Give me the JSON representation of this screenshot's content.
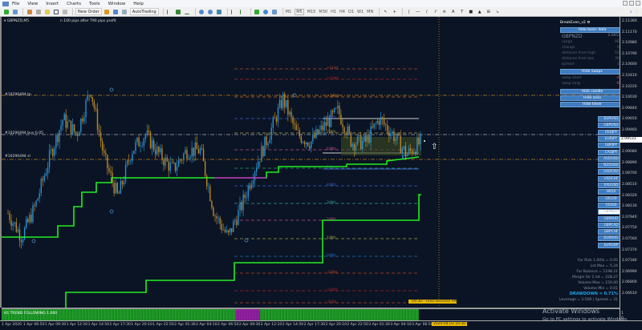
{
  "menu": [
    "File",
    "View",
    "Insert",
    "Charts",
    "Tools",
    "Window",
    "Help"
  ],
  "toolbar": {
    "new_order": "New Order",
    "autotrading": "AutoTrading",
    "timeframes": [
      "M1",
      "M5",
      "M15",
      "M30",
      "H1",
      "H4",
      "D1",
      "W1",
      "MN"
    ]
  },
  "chart": {
    "symbol_label": "GBPNZD,M5",
    "info_text": "n 100 pips after T90 pips profit",
    "indicator_name": "BreakEven_v2",
    "line_labels": [
      "#10290494 tp",
      "#10290494 buy 0.05",
      "#10290494 sl"
    ],
    "murrey_levels": [
      "+1/3d",
      "+2/8th",
      "+1/8th",
      "8/8th",
      "7/8th",
      "6/8th",
      "5/8th",
      "4/8th",
      "3/8th",
      "2/8th",
      "1/8th",
      "0/8th",
      "-1/8th",
      "-2/8th",
      "-1/3d"
    ],
    "news_label": "09:30 - Final Services PMI",
    "subwindow_label": "H1 TREND FOLLOWING 1.000"
  },
  "panel": {
    "hide_basic": "Hide basic data",
    "symbol": "GBPNZD",
    "price": "2.09533",
    "rows": [
      {
        "k": "range",
        "v": "86.4"
      },
      {
        "k": "change",
        "v": "0.0"
      },
      {
        "k": "distance from high",
        "v": "55.8"
      },
      {
        "k": "distance from low",
        "v": "30.6"
      },
      {
        "k": "spread",
        "v": "3.1"
      }
    ],
    "hide_swaps": "Hide swaps",
    "swaps": [
      {
        "k": "swap short",
        "v": "-4.1"
      },
      {
        "k": "swap long",
        "v": "-8.4"
      }
    ],
    "hide_candle": "Hide candle",
    "hide_area": "Hide area",
    "hide_timer": "Hide timer"
  },
  "symbols": [
    "EURUSD",
    "GBPUSD",
    "USDJPY",
    "EURJPY",
    "GBPJPY",
    "CADJPY",
    "AUDUSD",
    "NZDUSD",
    "USDCAD",
    "USDCHF",
    "XAUUSD",
    "HK50",
    "UK100",
    "US500",
    "GBPNZD",
    "GBPAUD",
    "GBPCAD",
    "GBPCHF",
    "EURAUD",
    "EURGBP"
  ],
  "selected_symbol": "GBPNZD",
  "stats": [
    "For Risk 1.00% = 0.05",
    "Lot Max = 5.24",
    "For Balance = 1198.21",
    "Margin for 1 lot = 228.27",
    "Volume Max = 150.00",
    "Volume Min = 0.01"
  ],
  "drawdown": "DRAWDOWN = 0.71%",
  "leverage": "Leverage = 1:500 | Spread = 31",
  "price_axis": [
    "2.11360",
    "2.11170",
    "2.10980",
    "2.10790",
    "2.10600",
    "2.10410",
    "2.10220",
    "2.10030",
    "2.09840",
    "2.09650",
    "2.09460",
    "2.09270",
    "2.09080",
    "2.08890",
    "2.08700",
    "2.08510",
    "2.08320",
    "2.08130",
    "2.07940",
    "2.07750",
    "2.07560",
    "2.07370",
    "2.07180",
    "2.06990",
    "2.06800",
    "2.06610"
  ],
  "current_price": "2.09533",
  "sub_axis": [
    "1",
    "0"
  ],
  "time_axis": [
    "1 Apr 2020",
    "1 Apr 06:50",
    "1 Apr 09:30",
    "1 Apr 12:10",
    "1 Apr 14:50",
    "1 Apr 17:30",
    "1 Apr 20:10",
    "1 Apr 22:50",
    "2 Apr 01:30",
    "2 Apr 04:10",
    "2 Apr 06:50",
    "2 Apr 09:30",
    "2 Apr 12:10",
    "2 Apr 14:50",
    "2 Apr 17:30",
    "2 Apr 20:10",
    "2 Apr 22:50",
    "3 Apr 01:30",
    "3 Apr 04:10",
    "3 Apr 06:50"
  ],
  "time_cursor": "2020.04.03 10:30",
  "watermark": {
    "title": "Activate Windows",
    "sub": "Go to PC settings to activate Windows."
  },
  "colors": {
    "bg": "#0b1424",
    "bull": "#2a8fd0",
    "bear": "#b8892a",
    "trail": "#22ee22",
    "button": "#3f7cc0",
    "drawdown": "#1aa3e8"
  },
  "chart_data": {
    "type": "candlestick",
    "symbol": "GBPNZD",
    "timeframe": "M5",
    "approx_close_path": [
      2.08,
      2.0759,
      2.0814,
      2.0896,
      2.0965,
      2.0938,
      2.1018,
      2.0896,
      2.0828,
      2.091,
      2.0938,
      2.0903,
      2.0876,
      2.091,
      2.091,
      2.08,
      2.0759,
      2.0814,
      2.0883,
      2.0938,
      2.1,
      2.0938,
      2.0924,
      2.0952,
      2.0979,
      2.0924,
      2.0924,
      2.0965,
      2.0938,
      2.0903,
      2.0924
    ]
  }
}
